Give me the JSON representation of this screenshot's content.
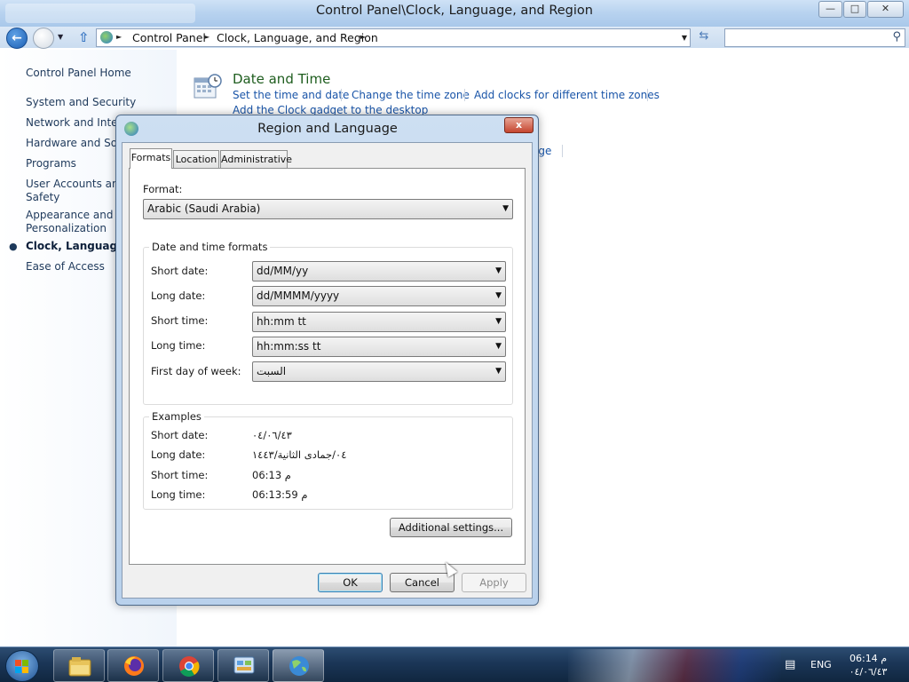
{
  "window": {
    "title": "Control Panel\\Clock, Language, and Region",
    "controls": {
      "minimize": "—",
      "maximize": "□",
      "close": "✕"
    }
  },
  "address_bar": {
    "crumbs": [
      "Control Panel",
      "Clock, Language, and Region"
    ],
    "search_placeholder": ""
  },
  "sidebar": {
    "items": [
      {
        "label": "Control Panel Home"
      },
      {
        "label": "System and Security"
      },
      {
        "label": "Network and Intern"
      },
      {
        "label": "Hardware and Sour"
      },
      {
        "label": "Programs"
      },
      {
        "label": "User Accounts and"
      },
      {
        "label": "Safety"
      },
      {
        "label": "Appearance and"
      },
      {
        "label": "Personalization"
      },
      {
        "label": "Clock, Language, a"
      },
      {
        "label": "Ease of Access"
      }
    ]
  },
  "main": {
    "category_title": "Date and Time",
    "links": [
      "Set the time and date",
      "Change the time zone",
      "Add clocks for different time zones",
      "Add the Clock gadget to the desktop"
    ],
    "partial_link": "ige"
  },
  "dialog": {
    "title": "Region and Language",
    "close": "x",
    "tabs": [
      "Formats",
      "Location",
      "Administrative"
    ],
    "format_label": "Format:",
    "format_value": "Arabic (Saudi Arabia)",
    "dt_group_label": "Date and time formats",
    "dt_rows": [
      {
        "label": "Short date:",
        "value": "dd/MM/yy"
      },
      {
        "label": "Long date:",
        "value": "dd/MMMM/yyyy"
      },
      {
        "label": "Short time:",
        "value": "hh:mm tt"
      },
      {
        "label": "Long time:",
        "value": "hh:mm:ss tt"
      },
      {
        "label": "First day of week:",
        "value": "السبت"
      }
    ],
    "examples_label": "Examples",
    "examples": [
      {
        "label": "Short date:",
        "value": "٠٤/٠٦/٤٣"
      },
      {
        "label": "Long date:",
        "value": "٠٤/جمادى الثانية/١٤٤٣"
      },
      {
        "label": "Short time:",
        "value": "06:13 م"
      },
      {
        "label": "Long time:",
        "value": "06:13:59 م"
      }
    ],
    "additional_settings": "Additional settings...",
    "ok": "OK",
    "cancel": "Cancel",
    "apply": "Apply"
  },
  "taskbar": {
    "apps": [
      "windows-explorer",
      "firefox",
      "chrome",
      "control-panel",
      "region-language"
    ],
    "language": "ENG",
    "time": "06:14 م",
    "date": "٠٤/٠٦/٤٣"
  },
  "icons": {
    "accent": "#1a55a8",
    "category_title_color": "#1e5d1e"
  }
}
